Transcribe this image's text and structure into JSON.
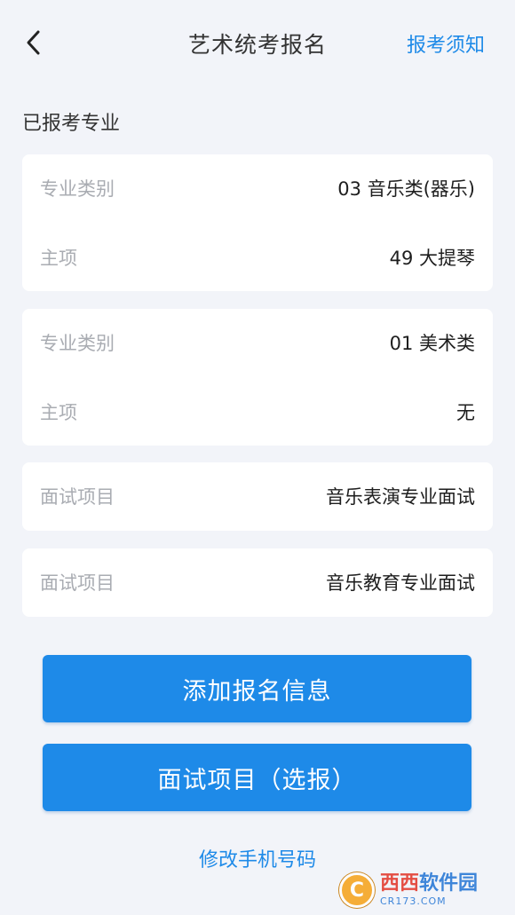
{
  "nav": {
    "title": "艺术统考报名",
    "right_link": "报考须知"
  },
  "section_label": "已报考专业",
  "cards": [
    {
      "rows": [
        {
          "key": "专业类别",
          "value": "03 音乐类(器乐)"
        },
        {
          "key": "主项",
          "value": "49 大提琴"
        }
      ]
    },
    {
      "rows": [
        {
          "key": "专业类别",
          "value": "01 美术类"
        },
        {
          "key": "主项",
          "value": "无"
        }
      ]
    },
    {
      "rows": [
        {
          "key": "面试项目",
          "value": "音乐表演专业面试"
        }
      ]
    },
    {
      "rows": [
        {
          "key": "面试项目",
          "value": "音乐教育专业面试"
        }
      ]
    }
  ],
  "buttons": {
    "add_info": "添加报名信息",
    "interview": "面试项目（选报）"
  },
  "change_phone_link": "修改手机号码",
  "watermark": {
    "logo_letter": "C",
    "main_red": "西西",
    "main_blue": "软件园",
    "sub": "CR173.COM"
  },
  "colors": {
    "accent": "#1e8ae8",
    "background": "#f2f4f9",
    "card": "#ffffff",
    "label": "#a9acb2"
  }
}
